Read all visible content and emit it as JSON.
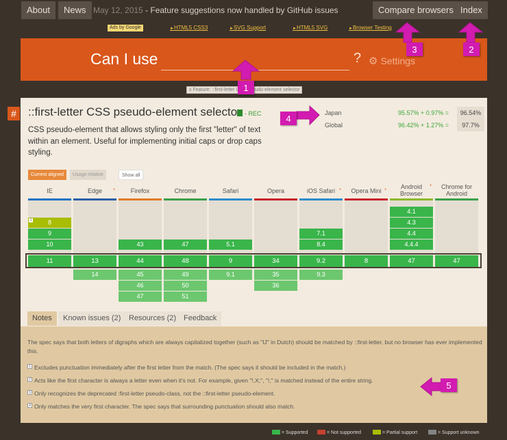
{
  "nav": {
    "about": "About",
    "news": "News",
    "date": "May 12, 2015",
    "announcement": " - Feature suggestions now handled by GitHub issues",
    "compare": "Compare browsers",
    "index": "Index"
  },
  "ads": {
    "badge": "Ads by Google",
    "links": [
      "HTML5 CSS3",
      "SVG Support",
      "HTML5 SVG",
      "Browser Testing"
    ]
  },
  "hero": {
    "title": "Can I use",
    "search_value": "",
    "qmark": "?",
    "settings": "Settings"
  },
  "filter": "x  Feature: ::first-letter CSS pseudo-element selector",
  "feature": {
    "hash": "#",
    "title": "::first-letter CSS pseudo-element selector",
    "status": "- REC",
    "description": "CSS pseudo-element that allows styling only the first \"letter\" of text within an element. Useful for implementing initial caps or drop caps styling."
  },
  "usage": [
    {
      "region": "Japan",
      "stats": "95.57% + 0.97% =",
      "total": "96.54%"
    },
    {
      "region": "Global",
      "stats": "96.42% + 1.27% =",
      "total": "97.7%"
    }
  ],
  "toggles": {
    "current": "Current aligned",
    "relative": "Usage relative",
    "show_all": "Show all"
  },
  "browsers": [
    {
      "name": "IE",
      "color": "#1a72c4",
      "star": false
    },
    {
      "name": "Edge",
      "color": "#2c5fa8",
      "star": true
    },
    {
      "name": "Firefox",
      "color": "#e07a27",
      "star": false
    },
    {
      "name": "Chrome",
      "color": "#3aa04a",
      "star": false
    },
    {
      "name": "Safari",
      "color": "#2c8ccc",
      "star": false
    },
    {
      "name": "Opera",
      "color": "#c8232c",
      "star": false
    },
    {
      "name": "iOS Safari",
      "color": "#2c8ccc",
      "star": true
    },
    {
      "name": "Opera Mini",
      "color": "#c8232c",
      "star": true
    },
    {
      "name": "Android Browser",
      "color": "#8bb92b",
      "star": true
    },
    {
      "name": "Chrome for Android",
      "color": "#3aa04a",
      "star": false
    }
  ],
  "versions": {
    "IE": {
      "past": [
        {
          "v": "8",
          "type": "partial",
          "note": "1"
        },
        {
          "v": "9",
          "type": "green"
        },
        {
          "v": "10",
          "type": "green"
        }
      ],
      "current": "11",
      "future": []
    },
    "Edge": {
      "past": [],
      "current": "13",
      "future": [
        "14"
      ]
    },
    "Firefox": {
      "past": [
        {
          "v": "43",
          "type": "green"
        }
      ],
      "current": "44",
      "future": [
        "45",
        "46",
        "47"
      ]
    },
    "Chrome": {
      "past": [
        {
          "v": "47",
          "type": "green"
        }
      ],
      "current": "48",
      "future": [
        "49",
        "50",
        "51"
      ]
    },
    "Safari": {
      "past": [
        {
          "v": "5.1",
          "type": "green"
        }
      ],
      "current": "9",
      "future": [
        "9.1"
      ]
    },
    "Opera": {
      "past": [],
      "current": "34",
      "future": [
        "35",
        "36"
      ]
    },
    "iOS Safari": {
      "past": [
        {
          "v": "7.1",
          "type": "green"
        },
        {
          "v": "8.4",
          "type": "green"
        }
      ],
      "current": "9.2",
      "future": [
        "9.3"
      ]
    },
    "Opera Mini": {
      "past": [],
      "current": "8",
      "future": []
    },
    "Android Browser": {
      "past": [
        {
          "v": "4.1",
          "type": "green"
        },
        {
          "v": "4.3",
          "type": "green"
        },
        {
          "v": "4.4",
          "type": "green"
        },
        {
          "v": "4.4.4",
          "type": "green"
        }
      ],
      "current": "47",
      "future": []
    },
    "Chrome for Android": {
      "past": [],
      "current": "47",
      "future": []
    }
  },
  "tabs": [
    "Notes",
    "Known issues (2)",
    "Resources (2)",
    "Feedback"
  ],
  "notes": {
    "main": "The spec says that both letters of digraphs which are always capitalized together (such as \"IJ\" in Dutch) should be matched by ::first-letter, but no browser has ever implemented this.",
    "items": [
      {
        "n": "1",
        "text": "Excludes punctuation immediately after the first letter from the match. (The spec says it should be included in the match.)"
      },
      {
        "n": "2",
        "text": "Acts like the first character is always a letter even when it's not. For example, given \"!,X;\", \"!,\" is matched instead of the entire string."
      },
      {
        "n": "3",
        "text": "Only recognizes the deprecated :first-letter pseudo-class, not the ::first-letter pseudo-element."
      },
      {
        "n": "4",
        "text": "Only matches the very first character. The spec says that surrounding punctuation should also match."
      }
    ]
  },
  "legend": [
    {
      "label": "= Supported",
      "color": "#39b54a"
    },
    {
      "label": "= Not supported",
      "color": "#c44230"
    },
    {
      "label": "= Partial support",
      "color": "#a8bd04"
    },
    {
      "label": "= Support unknown",
      "color": "#838383"
    }
  ],
  "markers": [
    "1",
    "2",
    "3",
    "4",
    "5"
  ],
  "colors": {
    "marker": "#d21bb0",
    "brand": "#d9571b"
  }
}
